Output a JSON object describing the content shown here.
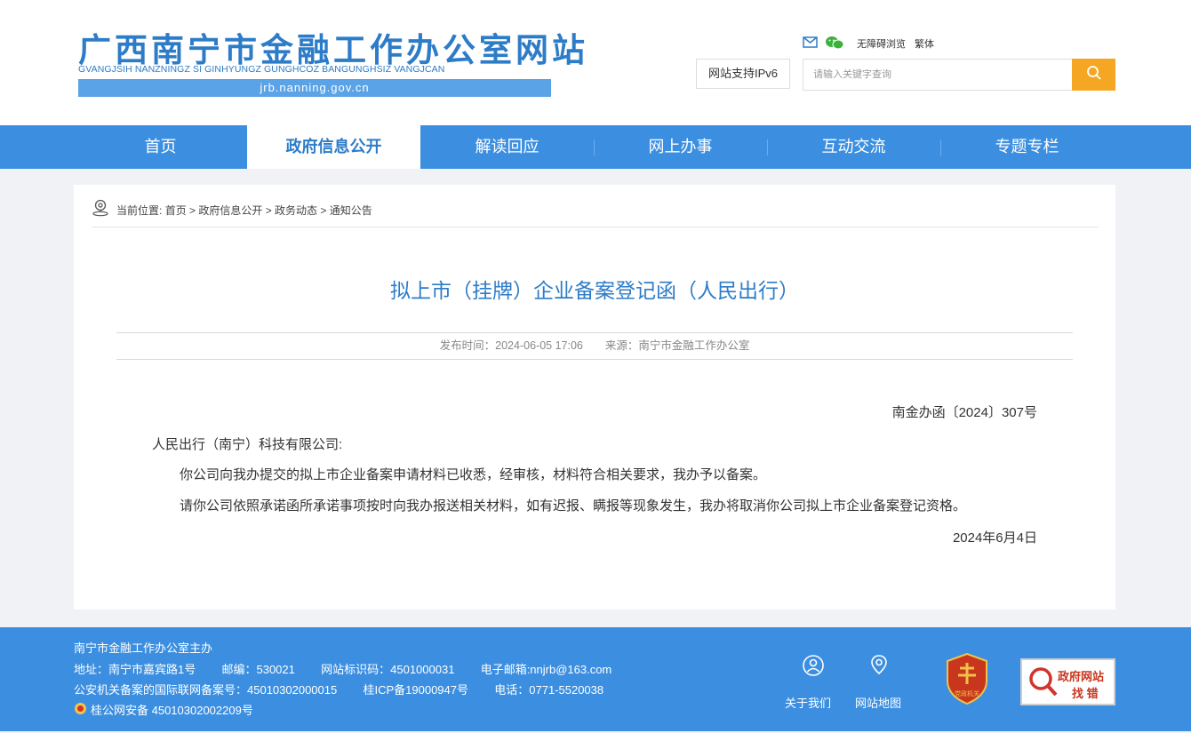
{
  "header": {
    "logo_title": "广西南宁市金融工作办公室网站",
    "logo_pinyin": "GVANGJSIH NANZNINGZ SI GINHYUNGZ GUNGHCOZ BANGUNGHSIZ VANGJCAN",
    "logo_domain": "jrb.nanning.gov.cn",
    "ipv6_label": "网站支持IPv6",
    "accessibility_label": "无障碍浏览",
    "traditional_label": "繁体",
    "search_placeholder": "请输入关键字查询",
    "accent_color": "#2d7cc8",
    "search_button_color": "#f5a623"
  },
  "nav": {
    "items": [
      "首页",
      "政府信息公开",
      "解读回应",
      "网上办事",
      "互动交流",
      "专题专栏"
    ],
    "active": "政府信息公开"
  },
  "breadcrumb": {
    "prefix": "当前位置:",
    "path": "首页 > 政府信息公开 > 政务动态 > 通知公告"
  },
  "article": {
    "title": "拟上市（挂牌）企业备案登记函（人民出行）",
    "publish_time": "发布时间：2024-06-05 17:06",
    "source": "来源：南宁市金融工作办公室",
    "doc_number": "南金办函〔2024〕307号",
    "salutation": "人民出行（南宁）科技有限公司:",
    "paragraph1": "你公司向我办提交的拟上市企业备案申请材料已收悉，经审核，材料符合相关要求，我办予以备案。",
    "paragraph2": "请你公司依照承诺函所承诺事项按时向我办报送相关材料，如有迟报、瞒报等现象发生，我办将取消你公司拟上市企业备案登记资格。",
    "date": "2024年6月4日"
  },
  "footer": {
    "sponsor": "南宁市金融工作办公室主办",
    "address": "地址：南宁市嘉宾路1号",
    "postcode": "邮编：530021",
    "site_code": "网站标识码：4501000031",
    "email": "电子邮箱:nnjrb@163.com",
    "police_record": "公安机关备案的国际联网备案号：45010302000015",
    "icp": "桂ICP备19000947号",
    "phone": "电话：0771-5520038",
    "public_security": "桂公网安备 45010302002209号",
    "about_label": "关于我们",
    "sitemap_label": "网站地图",
    "badge_text": "党政机关",
    "zhaocuo_line1": "政府网站",
    "zhaocuo_line2": "找 错"
  }
}
